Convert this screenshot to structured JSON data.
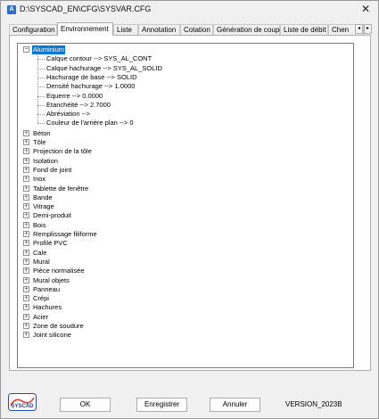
{
  "window": {
    "title": "D:\\SYSCAD_EN\\CFG\\SYSVAR.CFG",
    "app_icon": "A",
    "close": "✕"
  },
  "tabs": [
    {
      "label": "Configuration"
    },
    {
      "label": "Environnement"
    },
    {
      "label": "Liste"
    },
    {
      "label": "Annotation"
    },
    {
      "label": "Cotation"
    },
    {
      "label": "Génération de coupe"
    },
    {
      "label": "Liste de débit"
    },
    {
      "label": "Chen"
    }
  ],
  "tab_scroll": {
    "left": "◂",
    "right": "▸"
  },
  "tree": {
    "root": {
      "label": "Aluminium",
      "expander": "−",
      "children": [
        "Calque contour  -->  SYS_AL_CONT",
        "Calque hachurage  -->  SYS_AL_SOLID",
        "Hachurage de base  -->  SOLID",
        "Densité hachurage  -->  1.0000",
        "Equerre  -->  0.0000",
        "Etanchéité  -->  2.7000",
        "Abréviation  -->",
        "Couleur de l'arrière plan  -->  0"
      ]
    },
    "collapsed_expander": "+",
    "items": [
      "Béton",
      "Tôle",
      "Projection de la tôle",
      "Isolation",
      "Fond de joint",
      "Inox",
      "Tablette de fenêtre",
      "Bande",
      "Vitrage",
      "Demi-produit",
      "Bois",
      "Remplissage filiforme",
      "Profilé PVC",
      "Cale",
      "Mural",
      "Pièce normalisée",
      "Mural objets",
      "Panneau",
      "Crépi",
      "Hachures",
      "Acier",
      "Zone de soudure",
      "Joint silicone"
    ]
  },
  "footer": {
    "logo_text": "SYSCAD",
    "ok_label": "OK",
    "save_label": "Enregistrer",
    "cancel_label": "Annuler",
    "version": "VERSION_2023B"
  }
}
